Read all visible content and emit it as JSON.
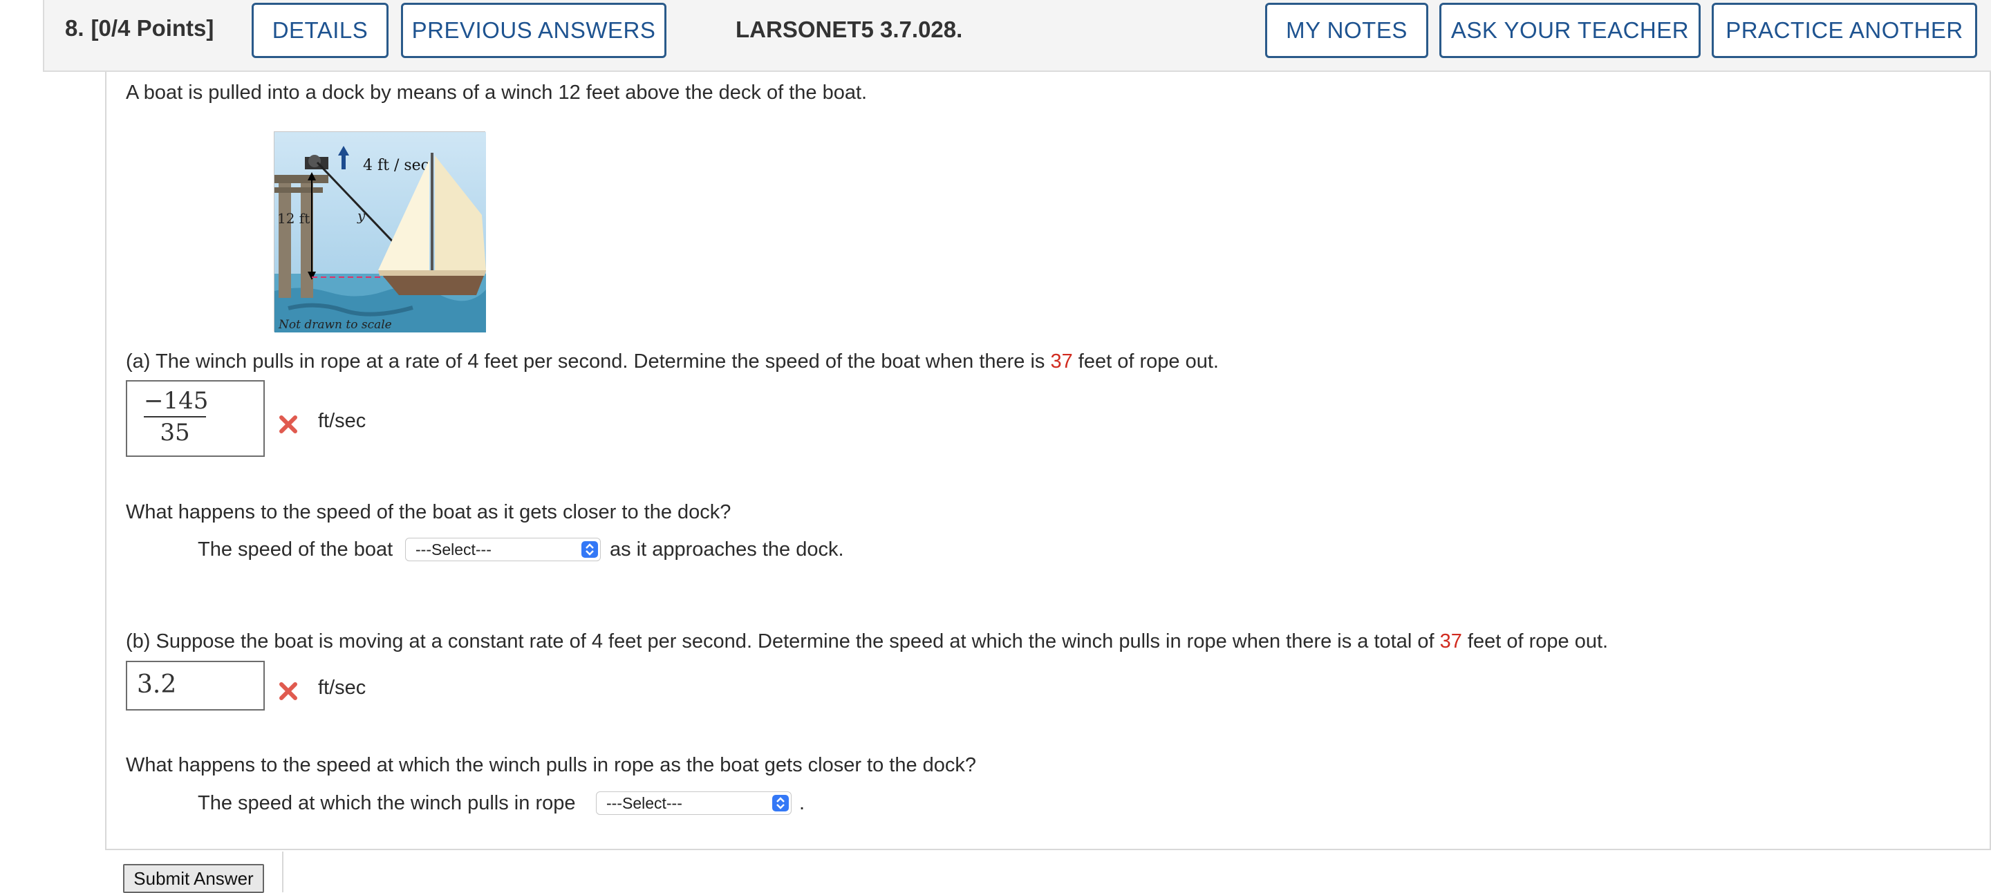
{
  "header": {
    "number": "8.",
    "points": "[0/4 Points]",
    "details": "DETAILS",
    "previous": "PREVIOUS ANSWERS",
    "ref": "LARSONET5 3.7.028.",
    "notes": "MY NOTES",
    "ask": "ASK YOUR TEACHER",
    "practice": "PRACTICE ANOTHER"
  },
  "problem": {
    "intro": "A boat is pulled into a dock by means of a winch 12 feet above the deck of the boat.",
    "figure": {
      "rate": "4 ft / sec",
      "height": "12 ft",
      "rope": "y",
      "note": "Not drawn to scale"
    },
    "a": {
      "text_before": "(a) The winch pulls in rope at a rate of 4 feet per second. Determine the speed of the boat when there is ",
      "value": "37",
      "text_after": " feet of rope out.",
      "answer_num": "−145",
      "answer_den": "35",
      "unit": "ft/sec",
      "q2": "What happens to the speed of the boat as it gets closer to the dock?",
      "q2_before": "The speed of the boat",
      "q2_select": "---Select---",
      "q2_after": "as it approaches the dock."
    },
    "b": {
      "text_before": "(b) Suppose the boat is moving at a constant rate of 4 feet per second. Determine the speed at which the winch pulls in rope when there is a total of ",
      "value": "37",
      "text_after": " feet of rope out.",
      "answer": "3.2",
      "unit": "ft/sec",
      "q2": "What happens to the speed at which the winch pulls in rope as the boat gets closer to the dock?",
      "q2_before": "The speed at which the winch pulls in rope",
      "q2_select": "---Select---",
      "q2_after": "."
    }
  },
  "submit": "Submit Answer",
  "colors": {
    "accent": "#1e5390",
    "error": "#d12b1f",
    "select": "#3478f6"
  }
}
